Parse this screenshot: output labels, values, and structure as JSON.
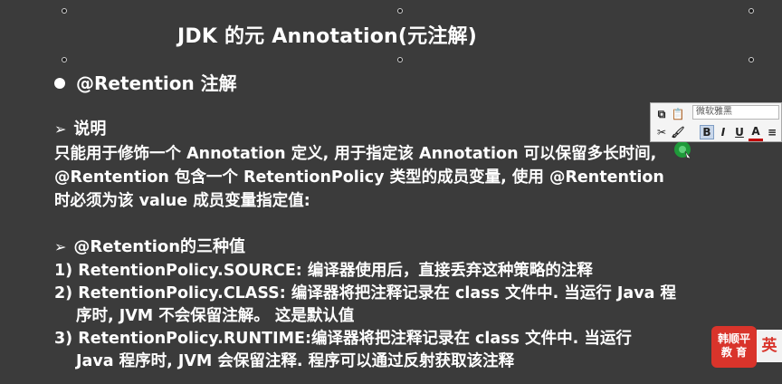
{
  "slide": {
    "title": "JDK 的元 Annotation(元注解)",
    "bullet": "@Retention 注解",
    "section1": {
      "heading": "说明",
      "lines": [
        "只能用于修饰一个 Annotation 定义, 用于指定该 Annotation 可以保留多长时间,",
        "@Rentention 包含一个 RetentionPolicy 类型的成员变量, 使用 @Rentention",
        "时必须为该 value 成员变量指定值:"
      ]
    },
    "section2": {
      "heading": "@Retention的三种值",
      "lines": [
        "1) RetentionPolicy.SOURCE: 编译器使用后，直接丢弃这种策略的注释",
        "2) RetentionPolicy.CLASS: 编译器将把注释记录在 class 文件中. 当运行 Java 程",
        "序时, JVM 不会保留注解。 这是默认值",
        "3) RetentionPolicy.RUNTIME:编译器将把注释记录在 class 文件中. 当运行",
        "Java 程序时, JVM 会保留注释. 程序可以通过反射获取该注释"
      ]
    }
  },
  "mini_toolbar": {
    "font_name": "微软雅黑",
    "bold": "B",
    "italic": "I",
    "underline": "U",
    "font_color": "A"
  },
  "logo": {
    "line1": "韩顺平",
    "line2": "教 育"
  },
  "ime_indicator": "英",
  "colors": {
    "slide_bg": "#3b3b3b",
    "text": "#ffffff",
    "logo_red": "#d9342b",
    "cursor_green": "#1f9a3a"
  }
}
